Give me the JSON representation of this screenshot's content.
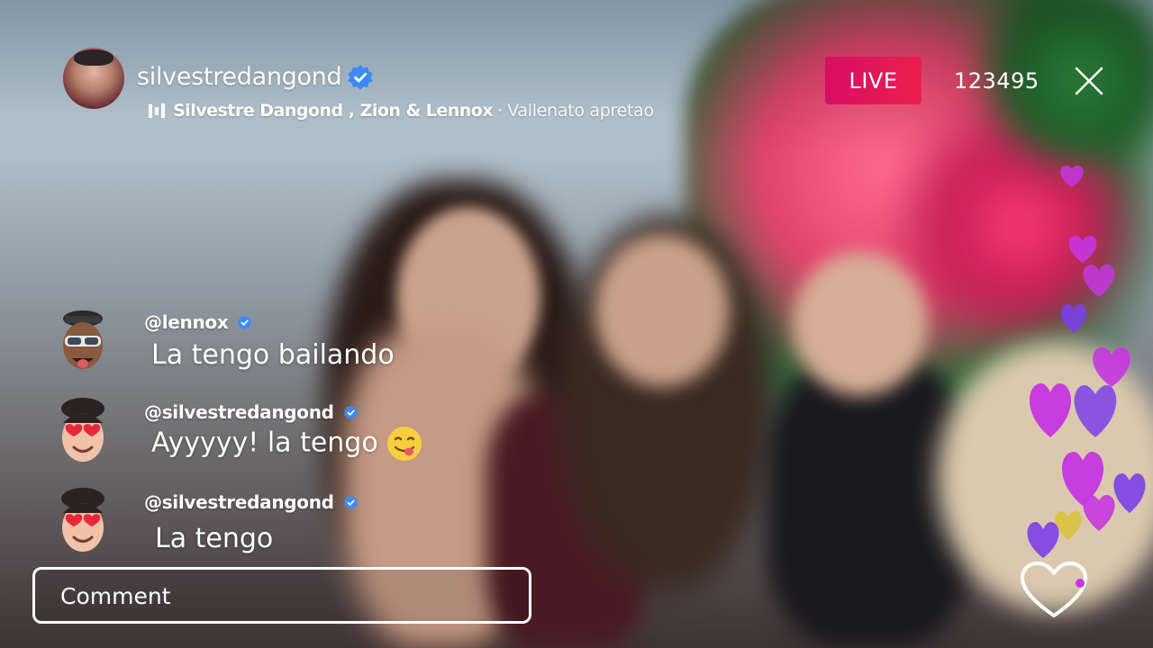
{
  "header": {
    "username": "silvestredangond",
    "song": {
      "artists": "Silvestre Dangond , Zion & Lennox",
      "separator": "·",
      "title": "Vallenato apretao"
    },
    "live_label": "LIVE",
    "viewer_count": "123495"
  },
  "comments": [
    {
      "user": "@lennox",
      "text": "La tengo bailando",
      "verified": true,
      "avatar": "lennox-memoji-avatar"
    },
    {
      "user": "@silvestredangond",
      "text": "Ayyyyy! la tengo",
      "emoji": "face-savoring-food-emoji",
      "verified": true,
      "avatar": "heart-eyes-memoji-avatar"
    },
    {
      "user": "@silvestredangond",
      "text": "La tengo",
      "verified": true,
      "avatar": "heart-eyes-memoji-avatar"
    }
  ],
  "comment_input": {
    "placeholder": "Comment"
  },
  "icons": {
    "close": "close-icon",
    "like": "heart-outline-icon",
    "verified": "verified-badge-icon",
    "music": "music-bars-icon"
  },
  "colors": {
    "live_badge": "#e0155a",
    "verified_blue": "#3d8af7",
    "heart_purple": "#c636e0",
    "heart_violet": "#7a40e8",
    "heart_yellow": "#d9c23c"
  }
}
